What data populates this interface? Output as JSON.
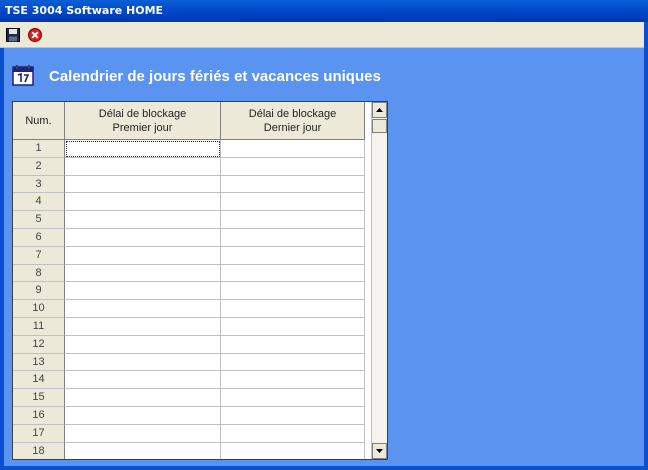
{
  "window": {
    "title": "TSE 3004 Software HOME"
  },
  "toolbar": {
    "save_icon": "save-icon",
    "close_icon": "close-icon"
  },
  "page": {
    "heading": "Calendrier de jours fériés et vacances uniques",
    "heading_icon": "calendar-icon"
  },
  "table": {
    "headers": {
      "num": "Num.",
      "first_line1": "Délai de blockage",
      "first_line2": "Premier jour",
      "last_line1": "Délai de blockage",
      "last_line2": "Dernier jour"
    },
    "rows": [
      {
        "num": "1",
        "first": "",
        "last": ""
      },
      {
        "num": "2",
        "first": "",
        "last": ""
      },
      {
        "num": "3",
        "first": "",
        "last": ""
      },
      {
        "num": "4",
        "first": "",
        "last": ""
      },
      {
        "num": "5",
        "first": "",
        "last": ""
      },
      {
        "num": "6",
        "first": "",
        "last": ""
      },
      {
        "num": "7",
        "first": "",
        "last": ""
      },
      {
        "num": "8",
        "first": "",
        "last": ""
      },
      {
        "num": "9",
        "first": "",
        "last": ""
      },
      {
        "num": "10",
        "first": "",
        "last": ""
      },
      {
        "num": "11",
        "first": "",
        "last": ""
      },
      {
        "num": "12",
        "first": "",
        "last": ""
      },
      {
        "num": "13",
        "first": "",
        "last": ""
      },
      {
        "num": "14",
        "first": "",
        "last": ""
      },
      {
        "num": "15",
        "first": "",
        "last": ""
      },
      {
        "num": "16",
        "first": "",
        "last": ""
      },
      {
        "num": "17",
        "first": "",
        "last": ""
      },
      {
        "num": "18",
        "first": "",
        "last": ""
      }
    ]
  },
  "colors": {
    "titlebar": "#0046c8",
    "content_bg": "#5a93f0",
    "heading_text": "#ffffff"
  }
}
